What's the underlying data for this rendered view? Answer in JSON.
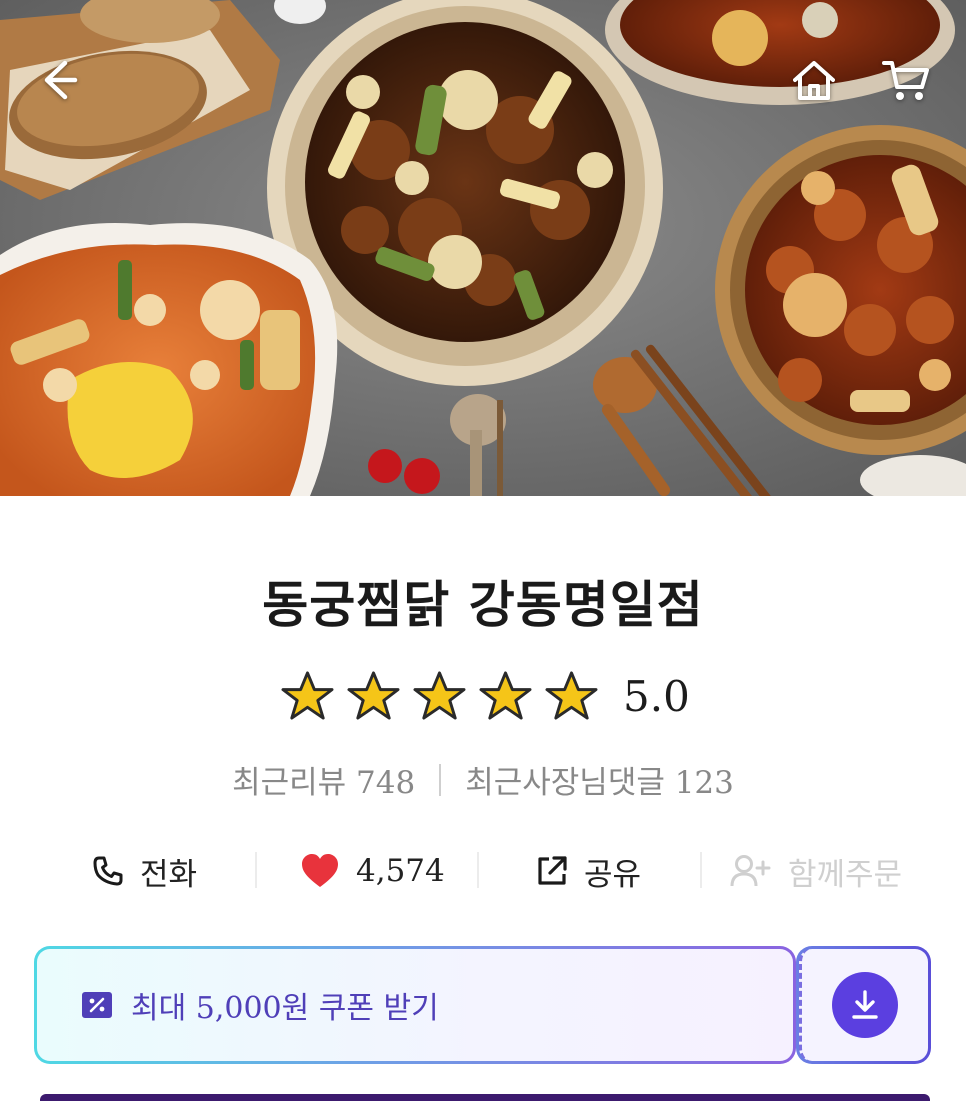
{
  "header": {
    "back_icon": "arrow-left-icon",
    "home_icon": "home-icon",
    "cart_icon": "cart-icon"
  },
  "store": {
    "name": "동궁찜닭 강동명일점",
    "rating": {
      "stars": 5,
      "max_stars": 5,
      "score": "5.0",
      "star_color": "#f5c518"
    },
    "reviews": {
      "recent_reviews_label": "최근리뷰 748",
      "owner_comments_label": "최근사장님댓글 123"
    }
  },
  "actions": {
    "phone": {
      "icon": "phone-icon",
      "label": "전화"
    },
    "like": {
      "icon": "heart-icon",
      "label": "4,574",
      "color": "#e8333c"
    },
    "share": {
      "icon": "share-icon",
      "label": "공유"
    },
    "group_order": {
      "icon": "add-user-icon",
      "label": "함께주문",
      "disabled": true
    }
  },
  "coupon": {
    "icon": "coupon-icon",
    "label": "최대 5,000원 쿠폰 받기",
    "download_icon": "download-icon",
    "accent": "#5b3fe0"
  }
}
